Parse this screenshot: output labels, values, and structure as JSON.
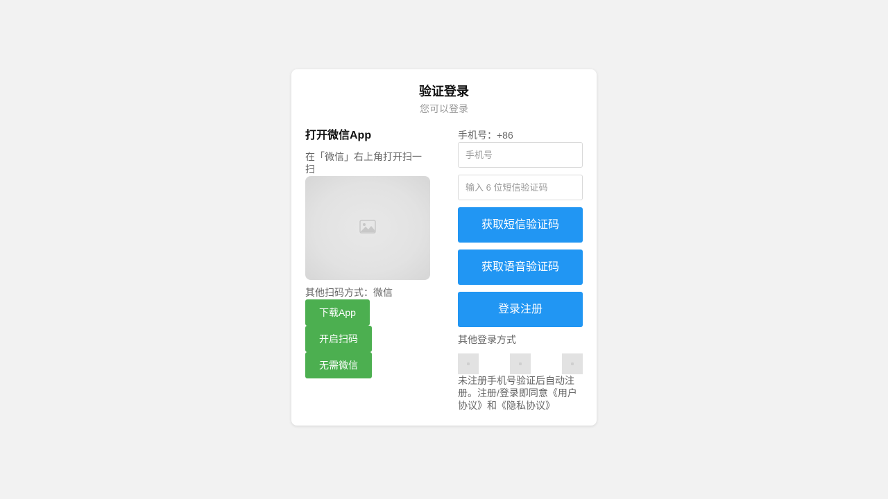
{
  "header": {
    "title": "验证登录",
    "subtitle": "您可以登录"
  },
  "qr_panel": {
    "heading": "打开微信App",
    "description": "在「微信」右上角打开扫一扫",
    "qr_icon": "image-placeholder-icon",
    "other_scan_text": "其他扫码方式：微信",
    "buttons": [
      {
        "label": "下载App"
      },
      {
        "label": "开启扫码"
      },
      {
        "label": "无需微信"
      }
    ],
    "button_color": "#4caf50"
  },
  "login_form": {
    "phone_label": "手机号：+86",
    "phone_input": {
      "placeholder": "手机号",
      "value": ""
    },
    "code_input": {
      "placeholder": "输入 6 位短信验证码",
      "value": ""
    },
    "sms_button": "获取短信验证码",
    "voice_button": "获取语音验证码",
    "submit_button": "登录注册",
    "button_color": "#2196f3",
    "other_login_label": "其他登录方式",
    "other_login_icons": [
      "login-method-1-icon",
      "login-method-2-icon",
      "login-method-3-icon"
    ],
    "terms": "未注册手机号验证后自动注册。注册/登录即同意《用户协议》和《隐私协议》"
  }
}
